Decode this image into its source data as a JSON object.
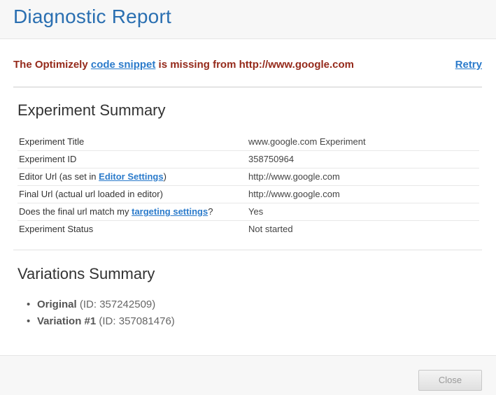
{
  "dialog": {
    "title": "Diagnostic Report"
  },
  "alert": {
    "prefix": "The Optimizely ",
    "link_text": "code snippet",
    "suffix": " is missing from http://www.google.com",
    "retry_label": "Retry"
  },
  "experiment_summary": {
    "title": "Experiment Summary",
    "rows": [
      {
        "label": "Experiment Title",
        "value": "www.google.com Experiment"
      },
      {
        "label": "Experiment ID",
        "value": "358750964"
      },
      {
        "label_prefix": "Editor Url (as set in ",
        "label_link": "Editor Settings",
        "label_suffix": ")",
        "value": "http://www.google.com"
      },
      {
        "label": "Final Url (actual url loaded in editor)",
        "value": "http://www.google.com"
      },
      {
        "label_prefix": "Does the final url match my ",
        "label_link": "targeting settings",
        "label_suffix": "?",
        "value": "Yes"
      },
      {
        "label": "Experiment Status",
        "value": "Not started"
      }
    ]
  },
  "variations_summary": {
    "title": "Variations Summary",
    "items": [
      {
        "name": "Original",
        "id_text": "(ID: 357242509)"
      },
      {
        "name": "Variation #1",
        "id_text": "(ID: 357081476)"
      }
    ]
  },
  "footer": {
    "close_label": "Close"
  },
  "bullet_glyph": "•"
}
